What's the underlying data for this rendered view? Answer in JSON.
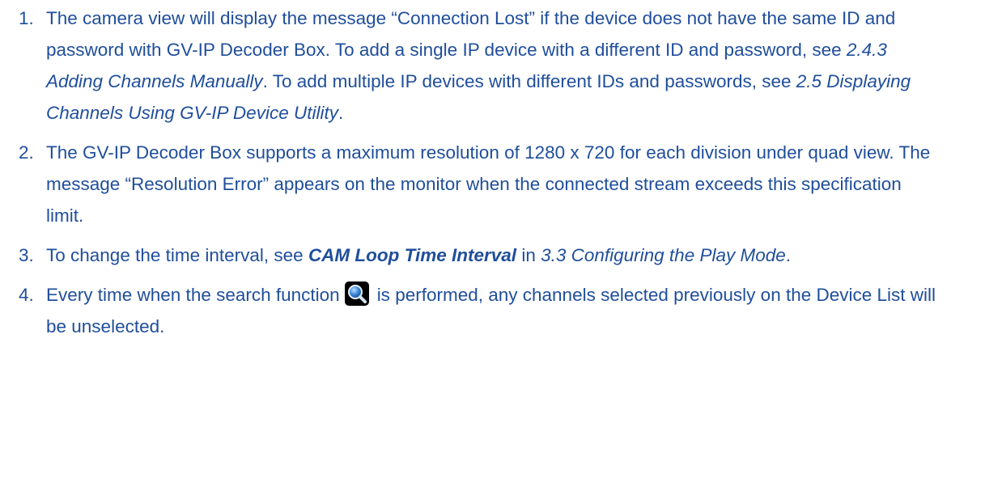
{
  "notes": [
    {
      "number": "1.",
      "text_a": "The camera view will display the message “Connection Lost” if the device does not have the same ID and password with GV-IP Decoder Box. To add a single IP device with a different ID and password, see ",
      "ref_a": "2.4.3 Adding Channels Manually",
      "text_b": ". To add multiple IP devices with different IDs and passwords, see ",
      "ref_b": "2.5 Displaying Channels Using GV-IP Device Utility",
      "text_c": "."
    },
    {
      "number": "2.",
      "text": "The GV-IP Decoder Box supports a maximum resolution of 1280 x 720 for each division under quad view. The message “Resolution Error” appears on the monitor when the connected stream exceeds this specification limit."
    },
    {
      "number": "3.",
      "text_a": "To change the time interval, see ",
      "strong_ref": "CAM Loop Time Interval",
      "text_b": " in ",
      "ref": "3.3 Configuring the Play Mode",
      "text_c": "."
    },
    {
      "number": "4.",
      "text_a": "Every time when the search function",
      "icon": "search-icon",
      "text_b": "is performed, any channels selected previously on the Device List will be unselected."
    }
  ],
  "colors": {
    "text": "#1f4e9b",
    "icon_background": "#000000",
    "icon_lens": "#3a86d8"
  }
}
